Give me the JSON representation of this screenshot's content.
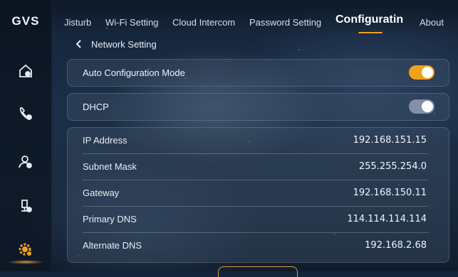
{
  "brand": {
    "logo_text": "GVS"
  },
  "sidebar": {
    "items": [
      {
        "icon": "home-settings-icon"
      },
      {
        "icon": "phone-icon"
      },
      {
        "icon": "user-settings-icon"
      },
      {
        "icon": "intercom-settings-icon"
      },
      {
        "icon": "gear-active-icon"
      }
    ],
    "accent_color": "#f0a21c"
  },
  "tabs": [
    {
      "label": "Jisturb"
    },
    {
      "label": "Wi-Fi Setting"
    },
    {
      "label": "Cloud Intercom"
    },
    {
      "label": "Password Setting"
    },
    {
      "label": "Configuratin",
      "active": true
    },
    {
      "label": "About"
    }
  ],
  "breadcrumb": {
    "label": "Network Setting"
  },
  "settings": {
    "auto_config": {
      "label": "Auto Configuration Mode",
      "enabled": true
    },
    "dhcp": {
      "label": "DHCP",
      "enabled": false
    }
  },
  "network_info": [
    {
      "label": "IP Address",
      "value": "192.168.151.15"
    },
    {
      "label": "Subnet Mask",
      "value": "255.255.254.0"
    },
    {
      "label": "Gateway",
      "value": "192.168.150.11"
    },
    {
      "label": "Primary DNS",
      "value": "114.114.114.114"
    },
    {
      "label": "Alternate DNS",
      "value": "192.168.2.68"
    }
  ]
}
